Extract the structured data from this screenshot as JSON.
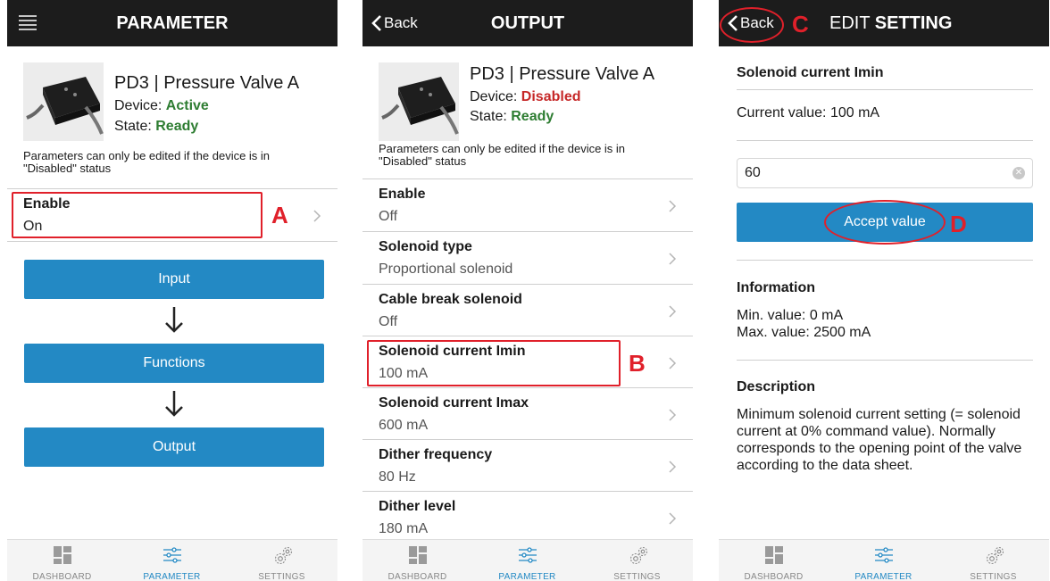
{
  "panel1": {
    "title": "PARAMETER",
    "device": {
      "name": "PD3 | Pressure Valve A",
      "device_label": "Device: ",
      "device_status": "Active",
      "state_label": "State: ",
      "state_status": "Ready"
    },
    "note": "Parameters can only be edited if the device is in \"Disabled\" status",
    "row": {
      "label": "Enable",
      "value": "On"
    },
    "buttons": [
      "Input",
      "Functions",
      "Output"
    ],
    "mark": "A"
  },
  "panel2": {
    "back": "Back",
    "title": "OUTPUT",
    "device": {
      "name": "PD3 | Pressure Valve A",
      "device_label": "Device: ",
      "device_status": "Disabled",
      "state_label": "State: ",
      "state_status": "Ready"
    },
    "note": "Parameters can only be edited if the device is in \"Disabled\" status",
    "rows": [
      {
        "label": "Enable",
        "value": "Off"
      },
      {
        "label": "Solenoid type",
        "value": "Proportional solenoid"
      },
      {
        "label": "Cable break solenoid",
        "value": "Off"
      },
      {
        "label": "Solenoid current Imin",
        "value": "100 mA"
      },
      {
        "label": "Solenoid current Imax",
        "value": "600 mA"
      },
      {
        "label": "Dither frequency",
        "value": "80 Hz"
      },
      {
        "label": "Dither level",
        "value": "180 mA"
      }
    ],
    "mark": "B"
  },
  "panel3": {
    "back": "Back",
    "title_light": "EDIT ",
    "title_bold": "SETTING",
    "param_name": "Solenoid current Imin",
    "current_value": "Current value: 100 mA",
    "input_value": "60",
    "accept": "Accept value",
    "info_title": "Information",
    "min": "Min. value: 0 mA",
    "max": "Max. value: 2500 mA",
    "desc_title": "Description",
    "desc": "Minimum solenoid current setting (= solenoid current at 0% command value). Normally corresponds to the opening point of the valve according to the data sheet.",
    "mark_c": "C",
    "mark_d": "D"
  },
  "tabbar": {
    "dashboard": "DASHBOARD",
    "parameter": "PARAMETER",
    "settings": "SETTINGS"
  },
  "colors": {
    "accent": "#2389c4",
    "header": "#1c1c1c",
    "active_green": "#2e7d32",
    "disabled_red": "#c62828",
    "annotation_red": "#e0202a"
  }
}
